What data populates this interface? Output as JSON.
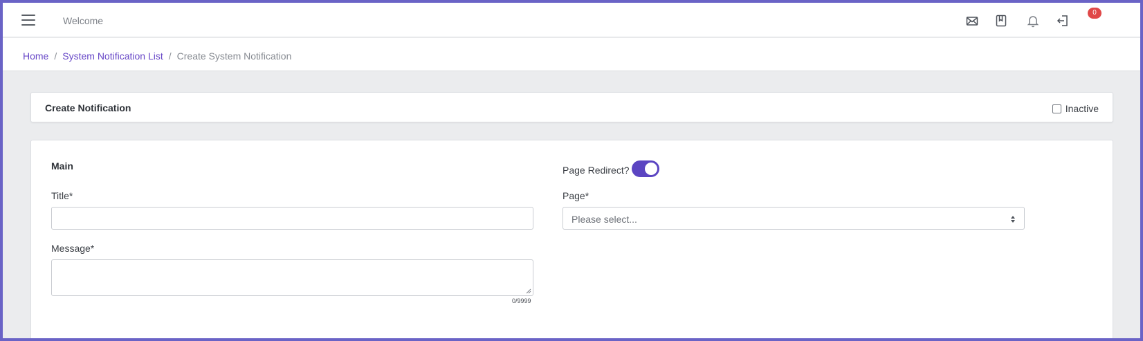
{
  "topbar": {
    "welcome": "Welcome",
    "notification_count": "0",
    "icons": [
      "hamburger-menu-icon",
      "mail-icon",
      "bookmark-icon",
      "bell-icon",
      "logout-icon"
    ]
  },
  "breadcrumb": {
    "items": [
      "Home",
      "System Notification List"
    ],
    "current": "Create System Notification",
    "separator": "/"
  },
  "header_card": {
    "title": "Create Notification",
    "inactive_label": "Inactive",
    "inactive_checked": false
  },
  "form": {
    "section_title": "Main",
    "title_label": "Title*",
    "title_value": "",
    "message_label": "Message*",
    "message_value": "",
    "message_counter": "0/9999",
    "page_redirect_label": "Page Redirect?",
    "page_redirect_on": true,
    "page_label": "Page*",
    "page_placeholder": "Please select..."
  },
  "colors": {
    "accent": "#5b45c2",
    "link": "#6747c7",
    "badge": "#e04848",
    "frame": "#6a63c6",
    "background": "#ebecee"
  }
}
